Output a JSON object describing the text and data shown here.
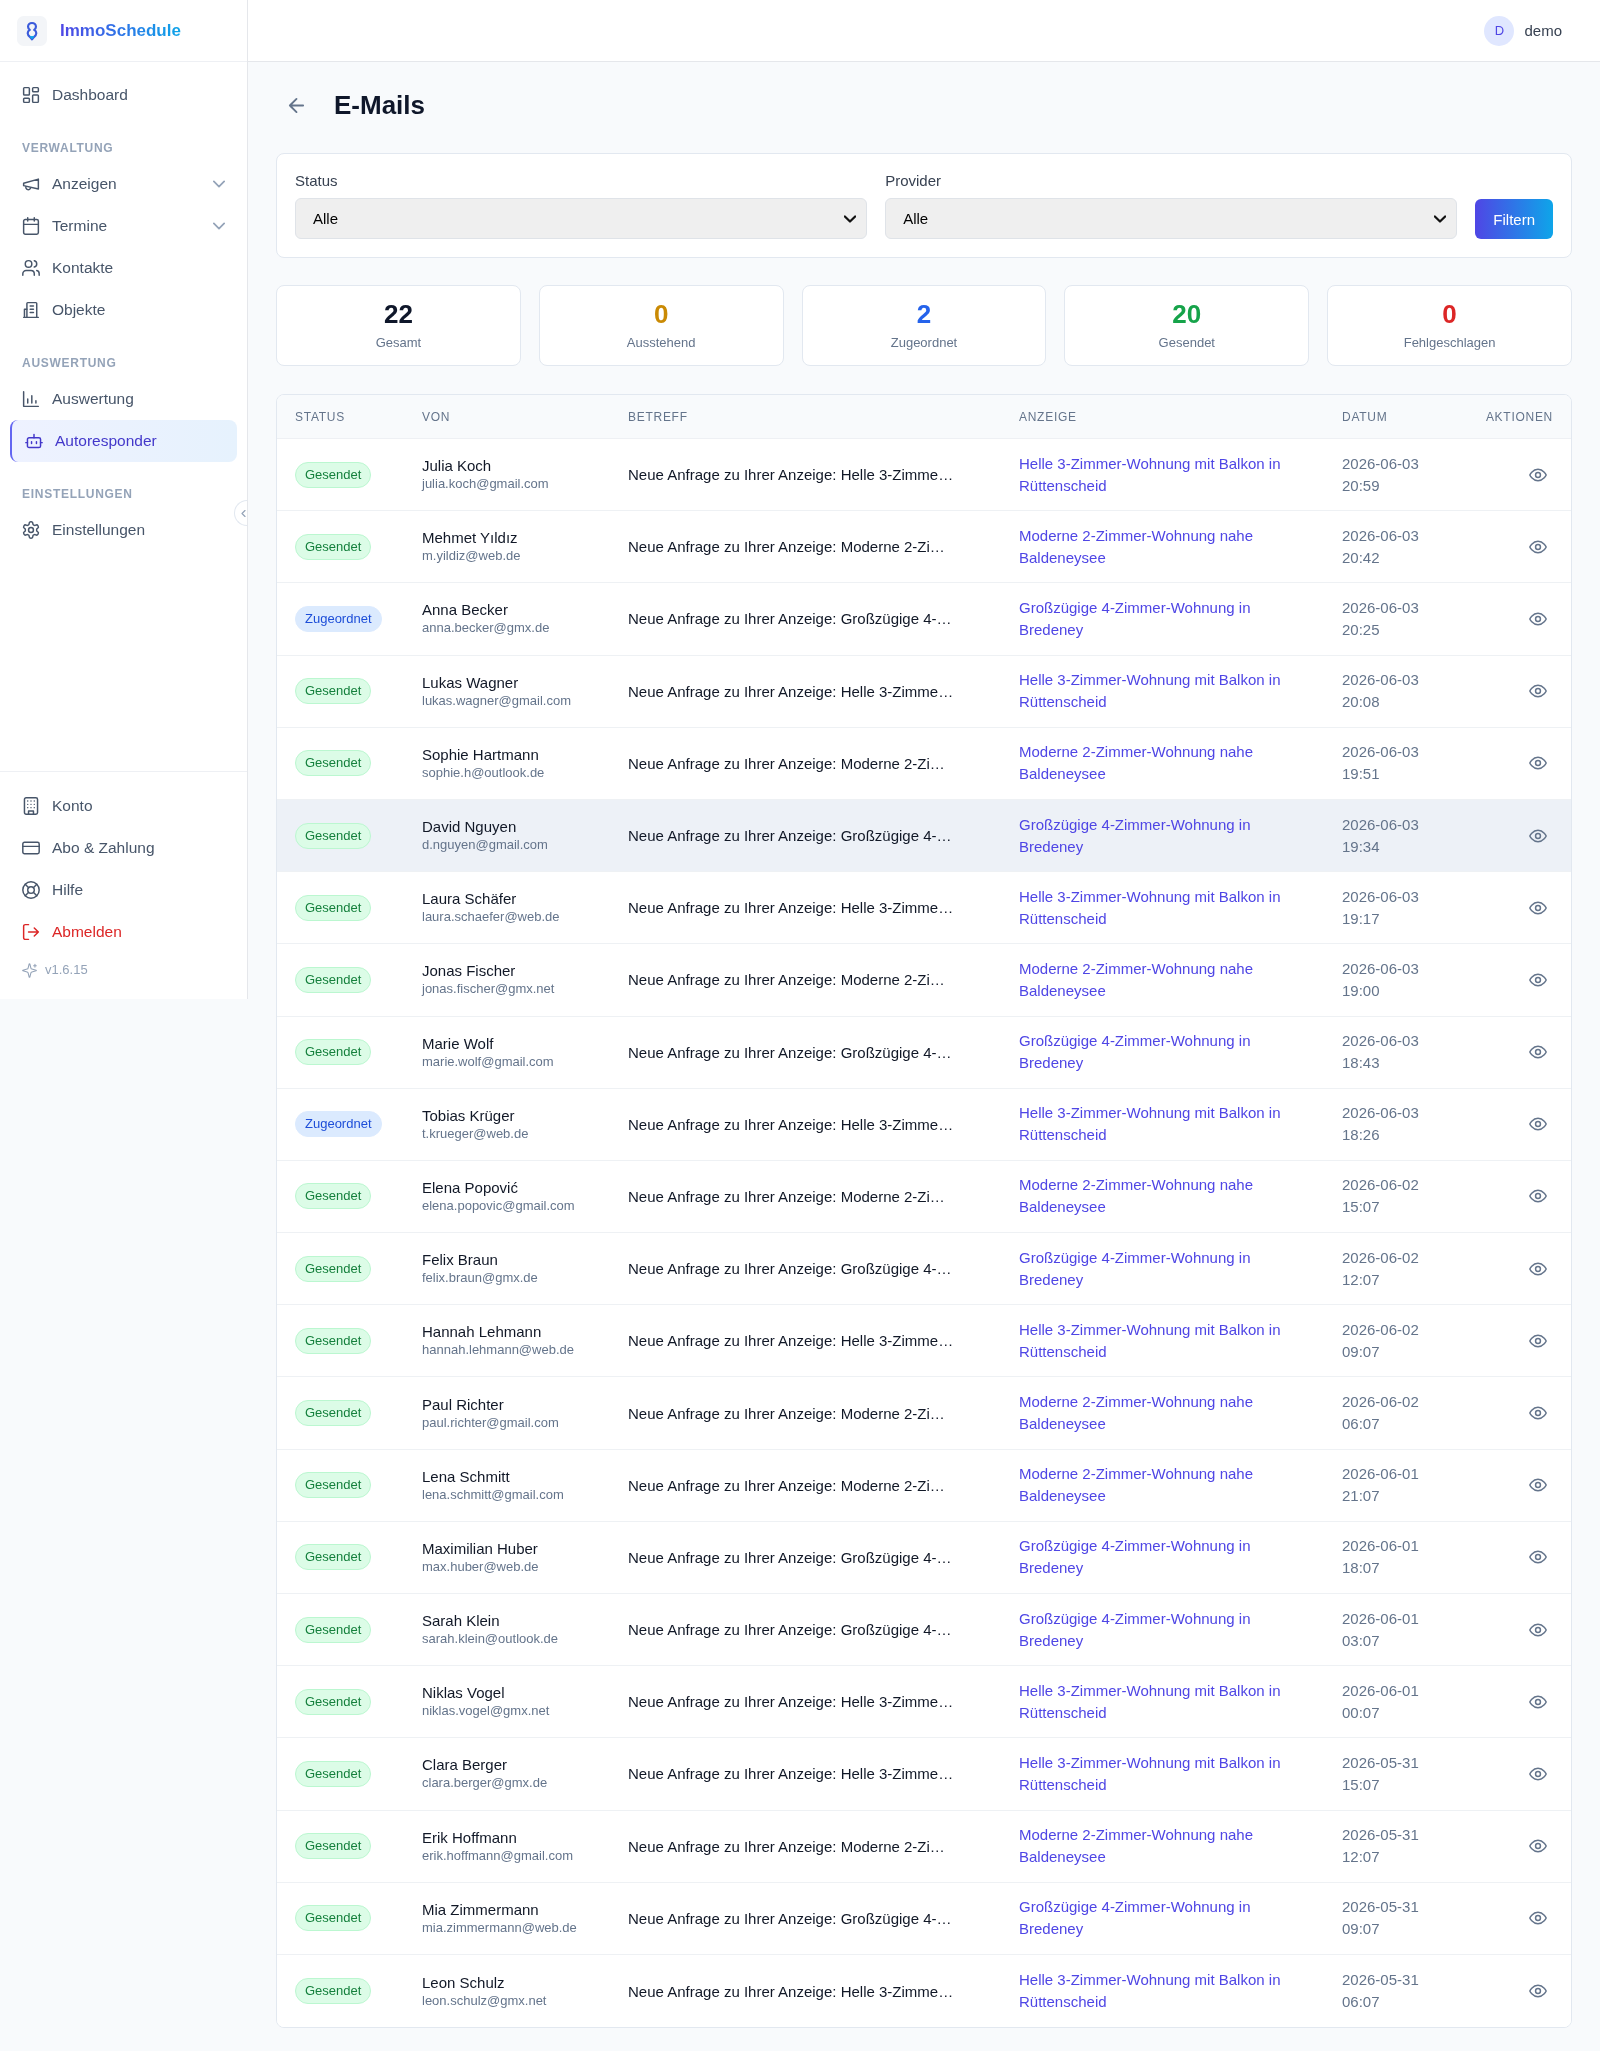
{
  "sidebar": {
    "brand": "ImmoSchedule",
    "sections": [
      {
        "items": [
          {
            "label": "Dashboard",
            "kind": "link",
            "selected": false
          }
        ]
      },
      {
        "heading": "VERWALTUNG",
        "items": [
          {
            "label": "Anzeigen",
            "kind": "group",
            "expanded": false,
            "selected": false
          },
          {
            "label": "Termine",
            "kind": "group",
            "expanded": false,
            "selected": false
          },
          {
            "label": "Kontakte",
            "kind": "link",
            "selected": false
          },
          {
            "label": "Objekte",
            "kind": "link",
            "selected": false
          }
        ]
      },
      {
        "heading": "AUSWERTUNG",
        "items": [
          {
            "label": "Auswertung",
            "kind": "link",
            "selected": false
          },
          {
            "label": "Autoresponder",
            "kind": "link",
            "selected": true
          }
        ]
      },
      {
        "heading": "EINSTELLUNGEN",
        "items": [
          {
            "label": "Einstellungen",
            "kind": "link",
            "selected": false
          }
        ]
      }
    ],
    "footer": [
      {
        "label": "Konto",
        "kind": "link",
        "selected": false
      },
      {
        "label": "Abo & Zahlung",
        "kind": "link",
        "selected": false
      },
      {
        "label": "Hilfe",
        "kind": "link",
        "selected": false
      },
      {
        "label": "Abmelden",
        "kind": "danger",
        "selected": false
      }
    ],
    "version": "v1.6.15"
  },
  "header": {
    "user": {
      "initial": "D",
      "name": "demo"
    }
  },
  "page": {
    "title": "E-Mails"
  },
  "filters": {
    "fields": [
      {
        "label": "Status",
        "value": "Alle"
      },
      {
        "label": "Provider",
        "value": "Alle"
      }
    ],
    "button": "Filtern"
  },
  "stats": [
    {
      "value": "22",
      "label": "Gesamt",
      "color": "#0f172a"
    },
    {
      "value": "0",
      "label": "Ausstehend",
      "color": "#ca8a04"
    },
    {
      "value": "2",
      "label": "Zugeordnet",
      "color": "#2563eb"
    },
    {
      "value": "20",
      "label": "Gesendet",
      "color": "#16a34a"
    },
    {
      "value": "0",
      "label": "Fehlgeschlagen",
      "color": "#dc2626"
    }
  ],
  "table": {
    "columns": [
      "STATUS",
      "VON",
      "BETREFF",
      "ANZEIGE",
      "DATUM",
      "AKTIONEN"
    ],
    "rows": [
      {
        "status": {
          "label": "Gesendet",
          "kind": "sent"
        },
        "name": "Julia Koch",
        "email": "julia.koch@gmail.com",
        "subject": "Neue Anfrage zu Ihrer Anzeige: Helle 3-Zimme…",
        "listing": "Helle 3-Zimmer-Wohnung mit Balkon in Rüttenscheid",
        "date": "2026-06-03 20:59",
        "highlighted": false
      },
      {
        "status": {
          "label": "Gesendet",
          "kind": "sent"
        },
        "name": "Mehmet Yıldız",
        "email": "m.yildiz@web.de",
        "subject": "Neue Anfrage zu Ihrer Anzeige: Moderne 2-Zi…",
        "listing": "Moderne 2-Zimmer-Wohnung nahe Baldeneysee",
        "date": "2026-06-03 20:42",
        "highlighted": false
      },
      {
        "status": {
          "label": "Zugeordnet",
          "kind": "assigned"
        },
        "name": "Anna Becker",
        "email": "anna.becker@gmx.de",
        "subject": "Neue Anfrage zu Ihrer Anzeige: Großzügige 4-…",
        "listing": "Großzügige 4-Zimmer-Wohnung in Bredeney",
        "date": "2026-06-03 20:25",
        "highlighted": false
      },
      {
        "status": {
          "label": "Gesendet",
          "kind": "sent"
        },
        "name": "Lukas Wagner",
        "email": "lukas.wagner@gmail.com",
        "subject": "Neue Anfrage zu Ihrer Anzeige: Helle 3-Zimme…",
        "listing": "Helle 3-Zimmer-Wohnung mit Balkon in Rüttenscheid",
        "date": "2026-06-03 20:08",
        "highlighted": false
      },
      {
        "status": {
          "label": "Gesendet",
          "kind": "sent"
        },
        "name": "Sophie Hartmann",
        "email": "sophie.h@outlook.de",
        "subject": "Neue Anfrage zu Ihrer Anzeige: Moderne 2-Zi…",
        "listing": "Moderne 2-Zimmer-Wohnung nahe Baldeneysee",
        "date": "2026-06-03 19:51",
        "highlighted": false
      },
      {
        "status": {
          "label": "Gesendet",
          "kind": "sent"
        },
        "name": "David Nguyen",
        "email": "d.nguyen@gmail.com",
        "subject": "Neue Anfrage zu Ihrer Anzeige: Großzügige 4-…",
        "listing": "Großzügige 4-Zimmer-Wohnung in Bredeney",
        "date": "2026-06-03 19:34",
        "highlighted": true
      },
      {
        "status": {
          "label": "Gesendet",
          "kind": "sent"
        },
        "name": "Laura Schäfer",
        "email": "laura.schaefer@web.de",
        "subject": "Neue Anfrage zu Ihrer Anzeige: Helle 3-Zimme…",
        "listing": "Helle 3-Zimmer-Wohnung mit Balkon in Rüttenscheid",
        "date": "2026-06-03 19:17",
        "highlighted": false
      },
      {
        "status": {
          "label": "Gesendet",
          "kind": "sent"
        },
        "name": "Jonas Fischer",
        "email": "jonas.fischer@gmx.net",
        "subject": "Neue Anfrage zu Ihrer Anzeige: Moderne 2-Zi…",
        "listing": "Moderne 2-Zimmer-Wohnung nahe Baldeneysee",
        "date": "2026-06-03 19:00",
        "highlighted": false
      },
      {
        "status": {
          "label": "Gesendet",
          "kind": "sent"
        },
        "name": "Marie Wolf",
        "email": "marie.wolf@gmail.com",
        "subject": "Neue Anfrage zu Ihrer Anzeige: Großzügige 4-…",
        "listing": "Großzügige 4-Zimmer-Wohnung in Bredeney",
        "date": "2026-06-03 18:43",
        "highlighted": false
      },
      {
        "status": {
          "label": "Zugeordnet",
          "kind": "assigned"
        },
        "name": "Tobias Krüger",
        "email": "t.krueger@web.de",
        "subject": "Neue Anfrage zu Ihrer Anzeige: Helle 3-Zimme…",
        "listing": "Helle 3-Zimmer-Wohnung mit Balkon in Rüttenscheid",
        "date": "2026-06-03 18:26",
        "highlighted": false
      },
      {
        "status": {
          "label": "Gesendet",
          "kind": "sent"
        },
        "name": "Elena Popović",
        "email": "elena.popovic@gmail.com",
        "subject": "Neue Anfrage zu Ihrer Anzeige: Moderne 2-Zi…",
        "listing": "Moderne 2-Zimmer-Wohnung nahe Baldeneysee",
        "date": "2026-06-02 15:07",
        "highlighted": false
      },
      {
        "status": {
          "label": "Gesendet",
          "kind": "sent"
        },
        "name": "Felix Braun",
        "email": "felix.braun@gmx.de",
        "subject": "Neue Anfrage zu Ihrer Anzeige: Großzügige 4-…",
        "listing": "Großzügige 4-Zimmer-Wohnung in Bredeney",
        "date": "2026-06-02 12:07",
        "highlighted": false
      },
      {
        "status": {
          "label": "Gesendet",
          "kind": "sent"
        },
        "name": "Hannah Lehmann",
        "email": "hannah.lehmann@web.de",
        "subject": "Neue Anfrage zu Ihrer Anzeige: Helle 3-Zimme…",
        "listing": "Helle 3-Zimmer-Wohnung mit Balkon in Rüttenscheid",
        "date": "2026-06-02 09:07",
        "highlighted": false
      },
      {
        "status": {
          "label": "Gesendet",
          "kind": "sent"
        },
        "name": "Paul Richter",
        "email": "paul.richter@gmail.com",
        "subject": "Neue Anfrage zu Ihrer Anzeige: Moderne 2-Zi…",
        "listing": "Moderne 2-Zimmer-Wohnung nahe Baldeneysee",
        "date": "2026-06-02 06:07",
        "highlighted": false
      },
      {
        "status": {
          "label": "Gesendet",
          "kind": "sent"
        },
        "name": "Lena Schmitt",
        "email": "lena.schmitt@gmail.com",
        "subject": "Neue Anfrage zu Ihrer Anzeige: Moderne 2-Zi…",
        "listing": "Moderne 2-Zimmer-Wohnung nahe Baldeneysee",
        "date": "2026-06-01 21:07",
        "highlighted": false
      },
      {
        "status": {
          "label": "Gesendet",
          "kind": "sent"
        },
        "name": "Maximilian Huber",
        "email": "max.huber@web.de",
        "subject": "Neue Anfrage zu Ihrer Anzeige: Großzügige 4-…",
        "listing": "Großzügige 4-Zimmer-Wohnung in Bredeney",
        "date": "2026-06-01 18:07",
        "highlighted": false
      },
      {
        "status": {
          "label": "Gesendet",
          "kind": "sent"
        },
        "name": "Sarah Klein",
        "email": "sarah.klein@outlook.de",
        "subject": "Neue Anfrage zu Ihrer Anzeige: Großzügige 4-…",
        "listing": "Großzügige 4-Zimmer-Wohnung in Bredeney",
        "date": "2026-06-01 03:07",
        "highlighted": false
      },
      {
        "status": {
          "label": "Gesendet",
          "kind": "sent"
        },
        "name": "Niklas Vogel",
        "email": "niklas.vogel@gmx.net",
        "subject": "Neue Anfrage zu Ihrer Anzeige: Helle 3-Zimme…",
        "listing": "Helle 3-Zimmer-Wohnung mit Balkon in Rüttenscheid",
        "date": "2026-06-01 00:07",
        "highlighted": false
      },
      {
        "status": {
          "label": "Gesendet",
          "kind": "sent"
        },
        "name": "Clara Berger",
        "email": "clara.berger@gmx.de",
        "subject": "Neue Anfrage zu Ihrer Anzeige: Helle 3-Zimme…",
        "listing": "Helle 3-Zimmer-Wohnung mit Balkon in Rüttenscheid",
        "date": "2026-05-31 15:07",
        "highlighted": false
      },
      {
        "status": {
          "label": "Gesendet",
          "kind": "sent"
        },
        "name": "Erik Hoffmann",
        "email": "erik.hoffmann@gmail.com",
        "subject": "Neue Anfrage zu Ihrer Anzeige: Moderne 2-Zi…",
        "listing": "Moderne 2-Zimmer-Wohnung nahe Baldeneysee",
        "date": "2026-05-31 12:07",
        "highlighted": false
      },
      {
        "status": {
          "label": "Gesendet",
          "kind": "sent"
        },
        "name": "Mia Zimmermann",
        "email": "mia.zimmermann@web.de",
        "subject": "Neue Anfrage zu Ihrer Anzeige: Großzügige 4-…",
        "listing": "Großzügige 4-Zimmer-Wohnung in Bredeney",
        "date": "2026-05-31 09:07",
        "highlighted": false
      },
      {
        "status": {
          "label": "Gesendet",
          "kind": "sent"
        },
        "name": "Leon Schulz",
        "email": "leon.schulz@gmx.net",
        "subject": "Neue Anfrage zu Ihrer Anzeige: Helle 3-Zimme…",
        "listing": "Helle 3-Zimmer-Wohnung mit Balkon in Rüttenscheid",
        "date": "2026-05-31 06:07",
        "highlighted": false
      }
    ]
  }
}
